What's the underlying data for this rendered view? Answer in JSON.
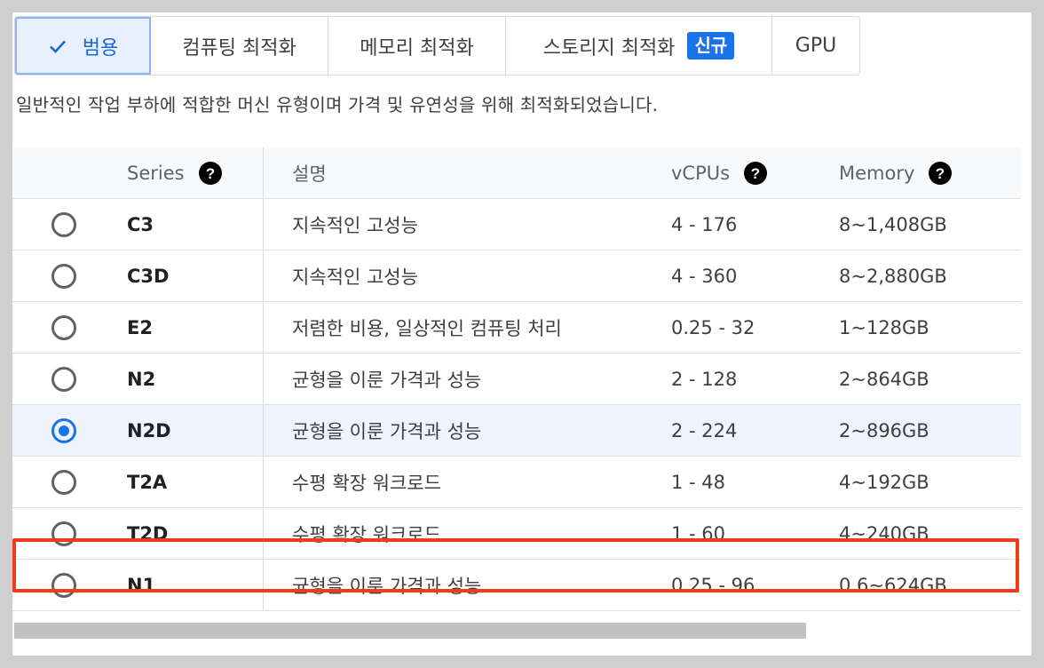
{
  "tabs": [
    {
      "label": "범용",
      "selected": true,
      "icon": "check-icon"
    },
    {
      "label": "컴퓨팅 최적화",
      "selected": false
    },
    {
      "label": "메모리 최적화",
      "selected": false
    },
    {
      "label": "스토리지 최적화",
      "selected": false,
      "badge": "신규"
    },
    {
      "label": "GPU",
      "selected": false
    }
  ],
  "description": "일반적인 작업 부하에 적합한 머신 유형이며 가격 및 유연성을 위해 최적화되었습니다.",
  "table": {
    "headers": {
      "series": "Series",
      "description": "설명",
      "vcpus": "vCPUs",
      "memory": "Memory"
    },
    "rows": [
      {
        "series": "C3",
        "description": "지속적인 고성능",
        "vcpus": "4 - 176",
        "memory": "8~1,408GB",
        "selected": false
      },
      {
        "series": "C3D",
        "description": "지속적인 고성능",
        "vcpus": "4 - 360",
        "memory": "8~2,880GB",
        "selected": false
      },
      {
        "series": "E2",
        "description": "저렴한 비용, 일상적인 컴퓨팅 처리",
        "vcpus": "0.25 - 32",
        "memory": "1~128GB",
        "selected": false
      },
      {
        "series": "N2",
        "description": "균형을 이룬 가격과 성능",
        "vcpus": "2 - 128",
        "memory": "2~864GB",
        "selected": false
      },
      {
        "series": "N2D",
        "description": "균형을 이룬 가격과 성능",
        "vcpus": "2 - 224",
        "memory": "2~896GB",
        "selected": true
      },
      {
        "series": "T2A",
        "description": "수평 확장 워크로드",
        "vcpus": "1 - 48",
        "memory": "4~192GB",
        "selected": false
      },
      {
        "series": "T2D",
        "description": "수평 확장 워크로드",
        "vcpus": "1 - 60",
        "memory": "4~240GB",
        "selected": false
      },
      {
        "series": "N1",
        "description": "균형을 이룬 가격과 성능",
        "vcpus": "0.25 - 96",
        "memory": "0.6~624GB",
        "selected": false
      }
    ]
  },
  "colors": {
    "accent": "#1a73e8",
    "highlight_border": "#f03a1a",
    "selected_tab_bg": "#e8f0fe"
  }
}
